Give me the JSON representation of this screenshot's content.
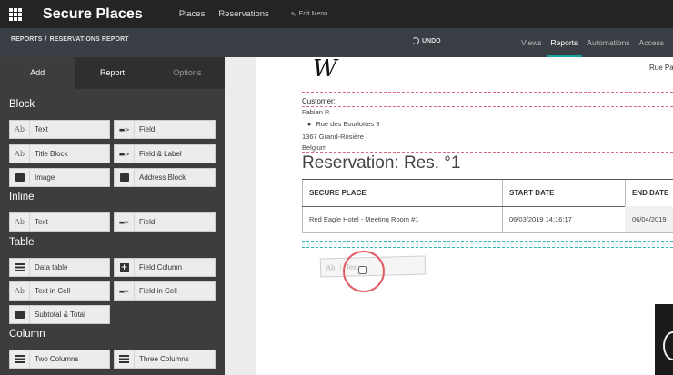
{
  "app": {
    "title": "Secure Places",
    "nav": [
      "Places",
      "Reservations"
    ],
    "edit_menu": "Edit Menu"
  },
  "breadcrumb": {
    "parent": "REPORTS",
    "separator": "/",
    "current": "RESERVATIONS REPORT"
  },
  "toolbar": {
    "undo": "UNDO"
  },
  "subtabs": [
    {
      "label": "Views",
      "active": false
    },
    {
      "label": "Reports",
      "active": true
    },
    {
      "label": "Automations",
      "active": false
    },
    {
      "label": "Access",
      "active": false
    }
  ],
  "panel": {
    "tabs": [
      "Add",
      "Report",
      "Options"
    ],
    "sections": {
      "block": "Block",
      "inline": "Inline",
      "table": "Table",
      "column": "Column"
    },
    "block_items": [
      "Text",
      "Field",
      "Title Block",
      "Field & Label",
      "Image",
      "Address Block"
    ],
    "inline_items": [
      "Text",
      "Field"
    ],
    "table_items": [
      "Data table",
      "Field Column",
      "Text in Cell",
      "Field in Cell",
      "Subtotal & Total"
    ],
    "column_items": [
      "Two Columns",
      "Three Columns"
    ]
  },
  "icons": {
    "text": "Ab",
    "field": "≡"
  },
  "document": {
    "header_right": "Rue Pa",
    "customer_label": "Customer:",
    "customer_lines": [
      "Fabien P.",
      "Rue des Bourlottes 9",
      "1367 Grand-Rosière",
      "Belgium"
    ],
    "title": "Reservation: Res. °1",
    "table": {
      "headers": [
        "SECURE PLACE",
        "START DATE",
        "END DATE"
      ],
      "row": [
        "Red Eagle Hotel - Meeting Room #1",
        "06/03/2019 14:16:17",
        "06/04/2019"
      ]
    },
    "drag_ghost": {
      "icon": "Ab",
      "label": "Text"
    }
  },
  "colors": {
    "accent": "#17a2a2",
    "click_ring": "#e05a63",
    "dashed_red": "#d86a7c"
  }
}
